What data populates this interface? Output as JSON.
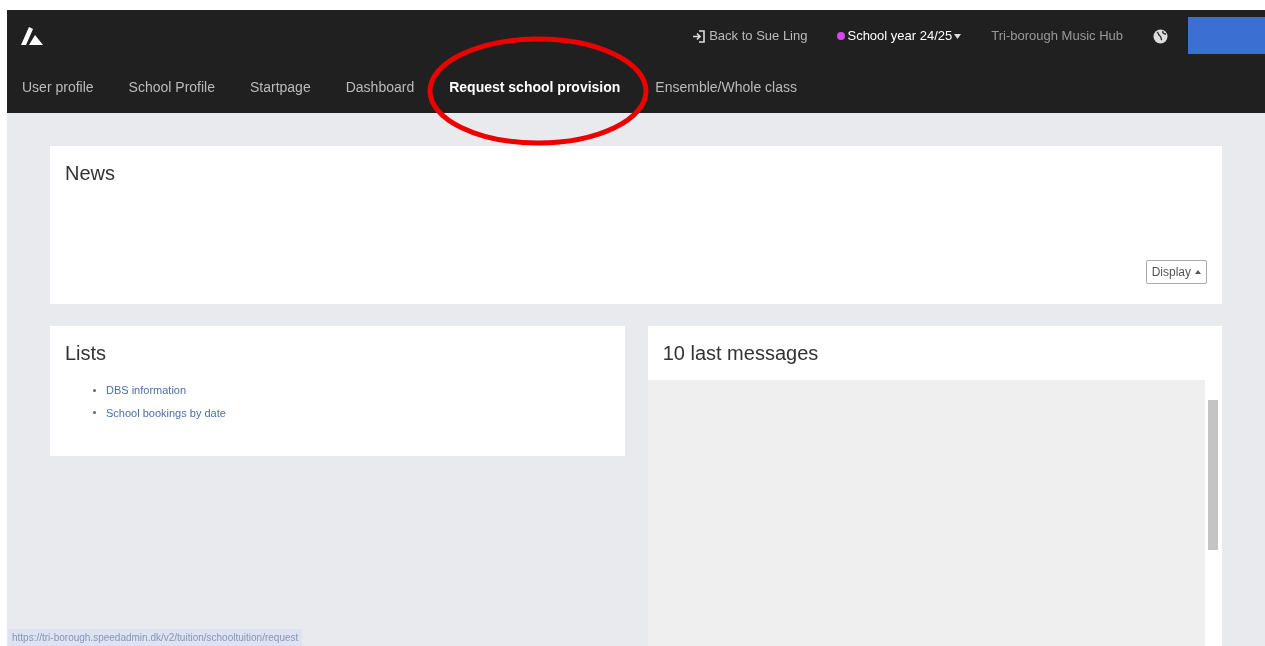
{
  "top_bar": {
    "back_link": "Back to Sue Ling",
    "school_year": {
      "label": "School year 24/25",
      "color": "#d946ef"
    },
    "organisation": "Tri-borough Music Hub"
  },
  "nav": [
    {
      "label": "User profile",
      "selected": false
    },
    {
      "label": "School Profile",
      "selected": false
    },
    {
      "label": "Startpage",
      "selected": false
    },
    {
      "label": "Dashboard",
      "selected": false
    },
    {
      "label": "Request school provision",
      "selected": true
    },
    {
      "label": "Ensemble/Whole class",
      "selected": false
    }
  ],
  "news": {
    "title": "News",
    "display_button": "Display"
  },
  "lists": {
    "title": "Lists",
    "items": [
      "DBS information",
      "School bookings by date"
    ]
  },
  "messages": {
    "title": "10 last messages"
  },
  "status_url": "https://tri-borough.speedadmin.dk/v2/tuition/schooltuition/request"
}
